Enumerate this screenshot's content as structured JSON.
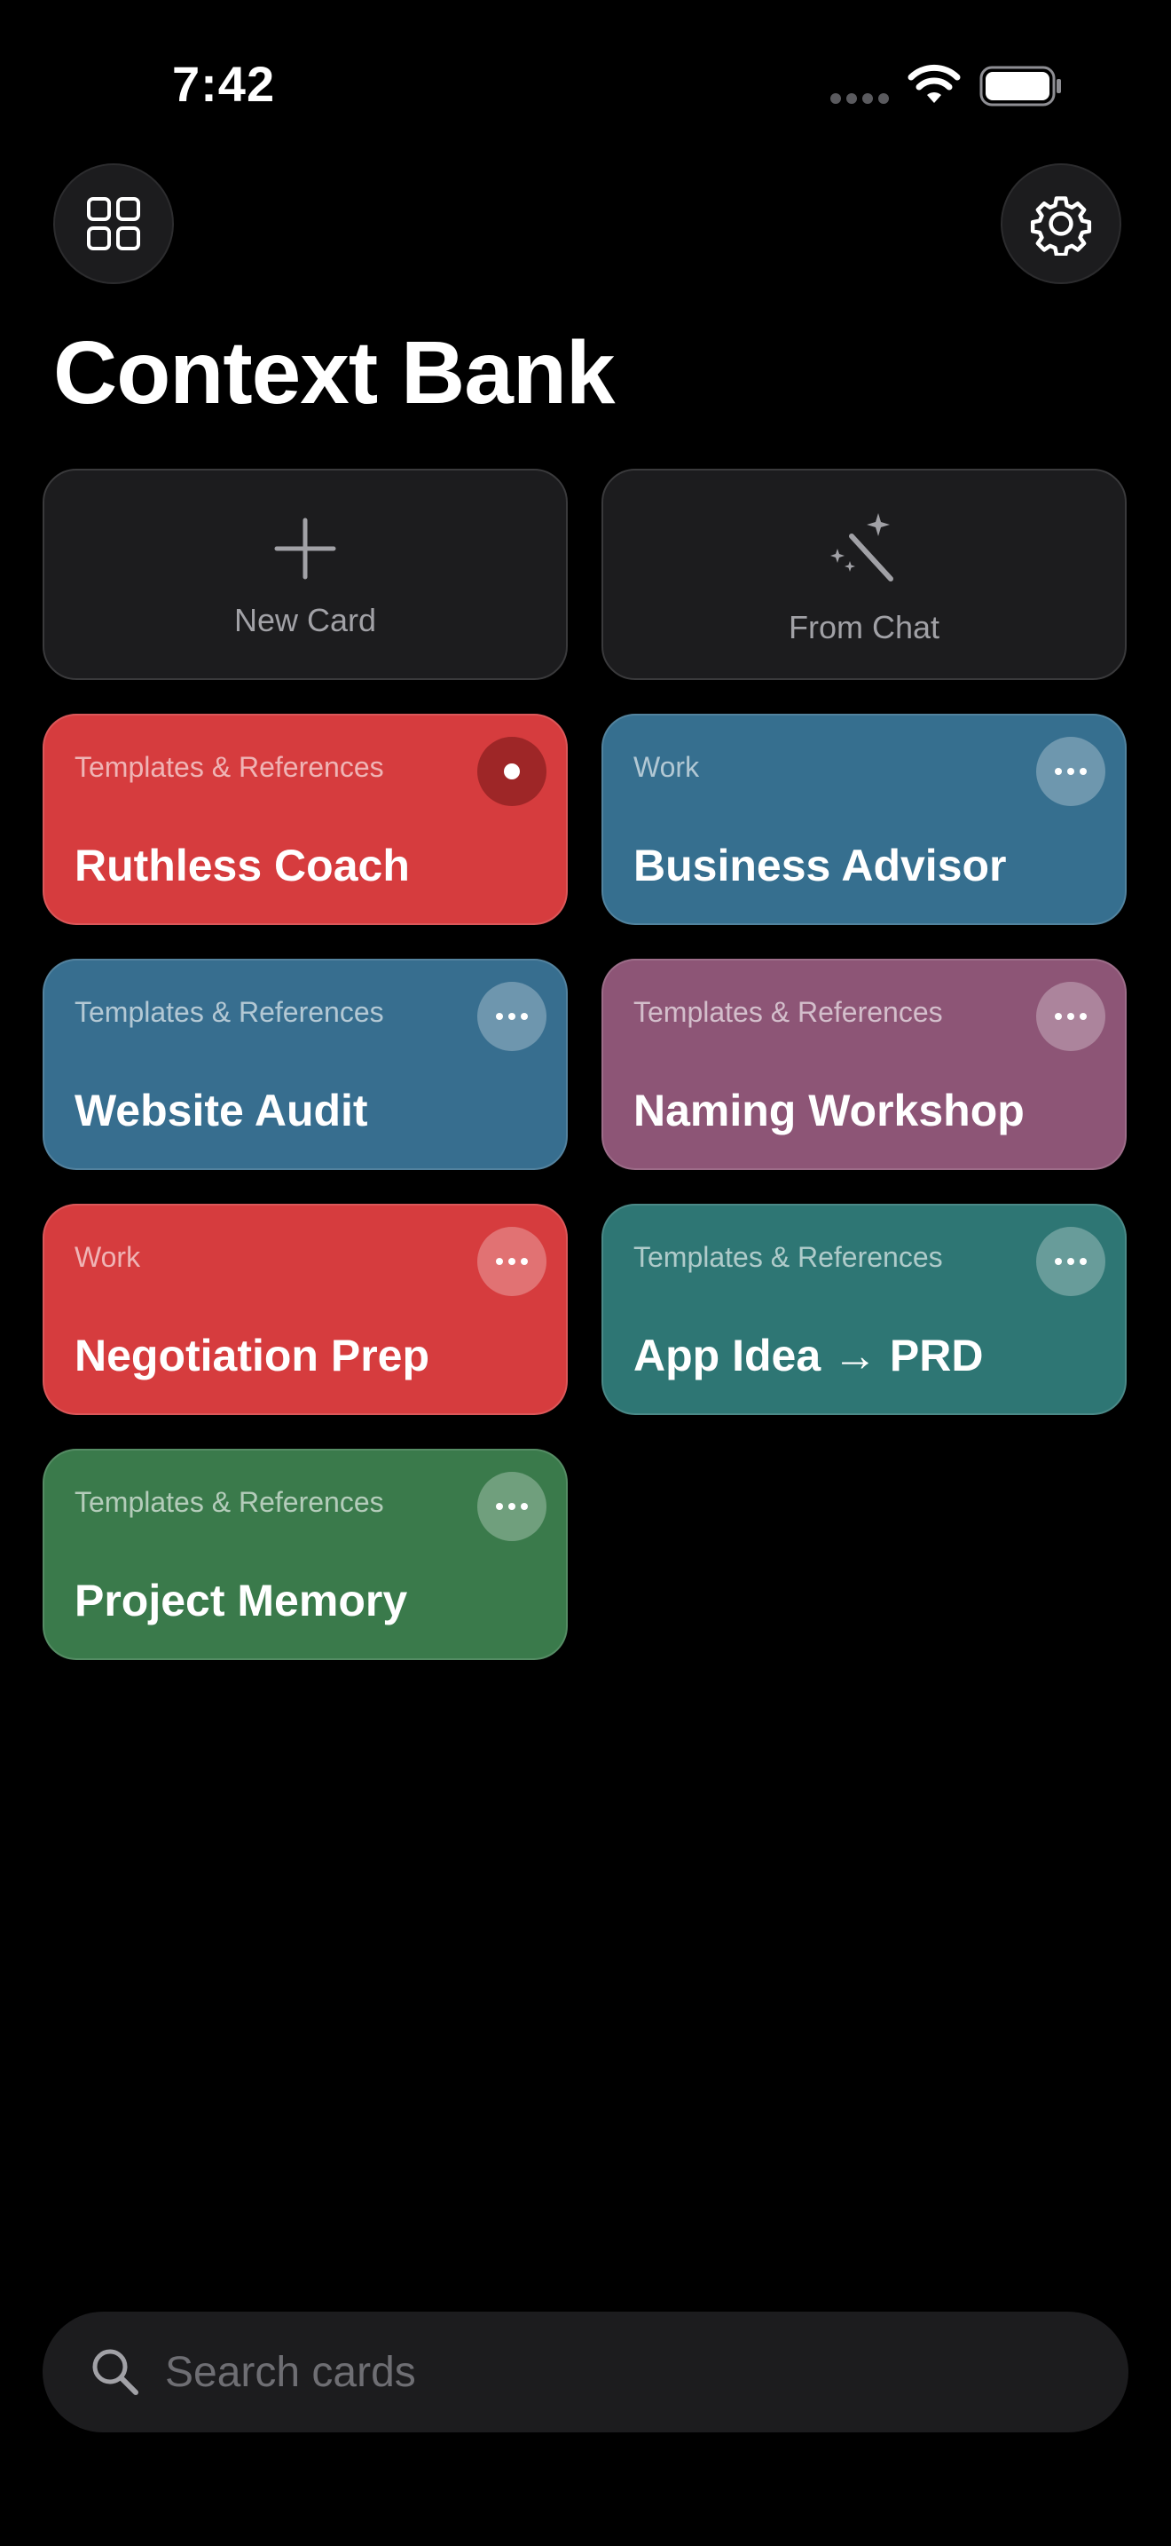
{
  "status_bar": {
    "time": "7:42"
  },
  "header": {
    "title": "Context Bank",
    "left_button_icon": "grid-icon",
    "right_button_icon": "gear-icon"
  },
  "actions": {
    "new_card_label": "New Card",
    "new_card_icon": "plus-icon",
    "from_chat_label": "From Chat",
    "from_chat_icon": "magic-wand-icon"
  },
  "cards": [
    {
      "category": "Templates & References",
      "title": "Ruthless Coach",
      "color": "#d63c3e",
      "menu_state": "active"
    },
    {
      "category": "Work",
      "title": "Business Advisor",
      "color": "#366f8f",
      "menu_state": "normal"
    },
    {
      "category": "Templates & References",
      "title": "Website Audit",
      "color": "#376e8f",
      "menu_state": "normal"
    },
    {
      "category": "Templates & References",
      "title": "Naming Workshop",
      "color": "#8d5576",
      "menu_state": "normal"
    },
    {
      "category": "Work",
      "title": "Negotiation Prep",
      "color": "#d63c3e",
      "menu_state": "normal"
    },
    {
      "category": "Templates & References",
      "title": "App Idea → PRD",
      "color": "#2e7674",
      "menu_state": "normal"
    },
    {
      "category": "Templates & References",
      "title": "Project Memory",
      "color": "#3a7a4b",
      "menu_state": "normal"
    }
  ],
  "search": {
    "placeholder": "Search cards",
    "value": ""
  }
}
